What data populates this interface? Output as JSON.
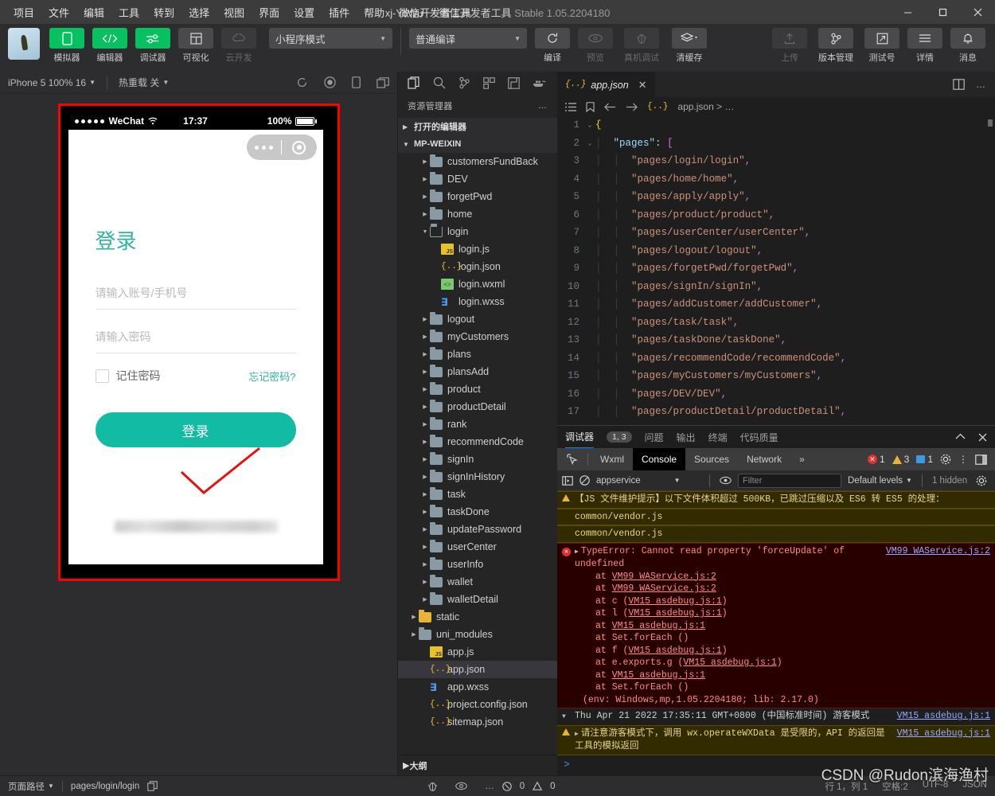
{
  "titlebar": {
    "menus": [
      "项目",
      "文件",
      "编辑",
      "工具",
      "转到",
      "选择",
      "视图",
      "界面",
      "设置",
      "插件",
      "帮助",
      "微信开发者工具"
    ],
    "project_name": "xj-YeWu",
    "separator": "－",
    "app_name": "微信开发者工具",
    "version": "Stable 1.05.2204180",
    "minimize": "—",
    "maximize": "▢",
    "close": "✕"
  },
  "toolbar": {
    "left_buttons": [
      {
        "label": "模拟器",
        "icon": "phone-icon",
        "state": "active"
      },
      {
        "label": "编辑器",
        "icon": "code-icon",
        "state": "active"
      },
      {
        "label": "调试器",
        "icon": "debug-sliders-icon",
        "state": "active"
      },
      {
        "label": "可视化",
        "icon": "layout-icon",
        "state": "normal"
      },
      {
        "label": "云开发",
        "icon": "cloud-icon",
        "state": "disabled"
      }
    ],
    "mode_select": "小程序模式",
    "compile_select": "普通编译",
    "mid_buttons": [
      {
        "label": "编译",
        "icon": "refresh-icon",
        "state": "normal"
      },
      {
        "label": "预览",
        "icon": "eye-icon",
        "state": "disabled"
      },
      {
        "label": "真机调试",
        "icon": "bug-icon",
        "state": "disabled"
      },
      {
        "label": "清缓存",
        "icon": "layers-icon",
        "state": "normal"
      }
    ],
    "right_buttons": [
      {
        "label": "上传",
        "icon": "upload-icon",
        "state": "disabled"
      },
      {
        "label": "版本管理",
        "icon": "branch-icon",
        "state": "normal"
      },
      {
        "label": "测试号",
        "icon": "external-link-icon",
        "state": "normal"
      },
      {
        "label": "详情",
        "icon": "menu-icon",
        "state": "normal"
      },
      {
        "label": "消息",
        "icon": "bell-icon",
        "state": "normal"
      }
    ]
  },
  "simulator": {
    "device": "iPhone 5 100% 16",
    "hot_reload": "热重载 关",
    "phone": {
      "status_carrier": "WeChat",
      "status_time": "17:37",
      "status_battery": "100%",
      "login_heading": "登录",
      "account_placeholder": "请输入账号/手机号",
      "password_placeholder": "请输入密码",
      "remember_label": "记住密码",
      "forgot_label": "忘记密码?",
      "submit_label": "登录"
    }
  },
  "explorer": {
    "title": "资源管理器",
    "open_editors": "打开的编辑器",
    "project_root": "MP-WEIXIN",
    "outline": "大纲",
    "tree": [
      {
        "name": "customersFundBack",
        "type": "folder",
        "indent": 2
      },
      {
        "name": "DEV",
        "type": "folder",
        "indent": 2
      },
      {
        "name": "forgetPwd",
        "type": "folder",
        "indent": 2
      },
      {
        "name": "home",
        "type": "folder",
        "indent": 2
      },
      {
        "name": "login",
        "type": "folder-open",
        "indent": 2
      },
      {
        "name": "login.js",
        "type": "js",
        "indent": 3
      },
      {
        "name": "login.json",
        "type": "json",
        "indent": 3
      },
      {
        "name": "login.wxml",
        "type": "wxml",
        "indent": 3
      },
      {
        "name": "login.wxss",
        "type": "wxss",
        "indent": 3
      },
      {
        "name": "logout",
        "type": "folder",
        "indent": 2
      },
      {
        "name": "myCustomers",
        "type": "folder",
        "indent": 2
      },
      {
        "name": "plans",
        "type": "folder",
        "indent": 2
      },
      {
        "name": "plansAdd",
        "type": "folder",
        "indent": 2
      },
      {
        "name": "product",
        "type": "folder",
        "indent": 2
      },
      {
        "name": "productDetail",
        "type": "folder",
        "indent": 2
      },
      {
        "name": "rank",
        "type": "folder",
        "indent": 2
      },
      {
        "name": "recommendCode",
        "type": "folder",
        "indent": 2
      },
      {
        "name": "signIn",
        "type": "folder",
        "indent": 2
      },
      {
        "name": "signInHistory",
        "type": "folder",
        "indent": 2
      },
      {
        "name": "task",
        "type": "folder",
        "indent": 2
      },
      {
        "name": "taskDone",
        "type": "folder",
        "indent": 2
      },
      {
        "name": "updatePassword",
        "type": "folder",
        "indent": 2
      },
      {
        "name": "userCenter",
        "type": "folder",
        "indent": 2
      },
      {
        "name": "userInfo",
        "type": "folder",
        "indent": 2
      },
      {
        "name": "wallet",
        "type": "folder",
        "indent": 2
      },
      {
        "name": "walletDetail",
        "type": "folder",
        "indent": 2
      },
      {
        "name": "static",
        "type": "folder-yellow",
        "indent": 1
      },
      {
        "name": "uni_modules",
        "type": "folder",
        "indent": 1
      },
      {
        "name": "app.js",
        "type": "js",
        "indent": 2
      },
      {
        "name": "app.json",
        "type": "json",
        "indent": 2,
        "selected": true
      },
      {
        "name": "app.wxss",
        "type": "wxss",
        "indent": 2
      },
      {
        "name": "project.config.json",
        "type": "json",
        "indent": 2
      },
      {
        "name": "sitemap.json",
        "type": "json",
        "indent": 2
      }
    ]
  },
  "editor": {
    "tab_name": "app.json",
    "tab_icon": "json-icon",
    "breadcrumb": "app.json > …",
    "lines": [
      {
        "n": 1,
        "fold": "v",
        "content": "{",
        "type": "brace"
      },
      {
        "n": 2,
        "fold": "v",
        "content": "\"pages\": [",
        "type": "key-open"
      },
      {
        "n": 3,
        "content": "\"pages/login/login\",",
        "type": "string"
      },
      {
        "n": 4,
        "content": "\"pages/home/home\",",
        "type": "string"
      },
      {
        "n": 5,
        "content": "\"pages/apply/apply\",",
        "type": "string"
      },
      {
        "n": 6,
        "content": "\"pages/product/product\",",
        "type": "string"
      },
      {
        "n": 7,
        "content": "\"pages/userCenter/userCenter\",",
        "type": "string"
      },
      {
        "n": 8,
        "content": "\"pages/logout/logout\",",
        "type": "string"
      },
      {
        "n": 9,
        "content": "\"pages/forgetPwd/forgetPwd\",",
        "type": "string"
      },
      {
        "n": 10,
        "content": "\"pages/signIn/signIn\",",
        "type": "string"
      },
      {
        "n": 11,
        "content": "\"pages/addCustomer/addCustomer\",",
        "type": "string"
      },
      {
        "n": 12,
        "content": "\"pages/task/task\",",
        "type": "string"
      },
      {
        "n": 13,
        "content": "\"pages/taskDone/taskDone\",",
        "type": "string"
      },
      {
        "n": 14,
        "content": "\"pages/recommendCode/recommendCode\",",
        "type": "string"
      },
      {
        "n": 15,
        "content": "\"pages/myCustomers/myCustomers\",",
        "type": "string"
      },
      {
        "n": 16,
        "content": "\"pages/DEV/DEV\",",
        "type": "string"
      },
      {
        "n": 17,
        "content": "\"pages/productDetail/productDetail\",",
        "type": "string"
      }
    ]
  },
  "debugger": {
    "tabs": [
      "调试器",
      "问题",
      "输出",
      "终端",
      "代码质量"
    ],
    "active_tab": "调试器",
    "count_badge": "1, 3",
    "devtools_tabs": [
      "Wxml",
      "Console",
      "Sources",
      "Network"
    ],
    "devtools_active": "Console",
    "more_tabs": "»",
    "error_count": "1",
    "warn_count": "3",
    "info_count": "1",
    "console": {
      "context": "appservice",
      "filter_placeholder": "Filter",
      "levels": "Default levels",
      "hidden": "1 hidden"
    },
    "messages": [
      {
        "kind": "warn",
        "text": "【JS 文件维护提示】以下文件体积超过 500KB，已跳过压缩以及 ES6 转 ES5 的处理：",
        "src": "",
        "partial": true
      },
      {
        "kind": "warn",
        "text": "common/vendor.js",
        "src": ""
      },
      {
        "kind": "warn",
        "text": "common/vendor.js",
        "src": ""
      },
      {
        "kind": "error",
        "text": "TypeError: Cannot read property 'forceUpdate' of undefined",
        "src": "VM99 WAService.js:2",
        "stack": [
          "at VM99 WAService.js:2",
          "at VM99 WAService.js:2",
          "at c (VM15 asdebug.js:1)",
          "at l (VM15 asdebug.js:1)",
          "at VM15 asdebug.js:1",
          "at Set.forEach (<anonymous>)",
          "at f (VM15 asdebug.js:1)",
          "at e.exports.g (VM15 asdebug.js:1)",
          "at VM15 asdebug.js:1",
          "at Set.forEach (<anonymous>)"
        ],
        "env": "(env: Windows,mp,1.05.2204180; lib: 2.17.0)"
      },
      {
        "kind": "plain",
        "text": "Thu Apr 21 2022 17:35:11 GMT+0800 (中国标准时间) 游客模式",
        "src": "VM15 asdebug.js:1"
      },
      {
        "kind": "warn2",
        "text": "请注意游客模式下，调用 wx.operateWXData 是受限的，API 的返回是工具的模拟返回",
        "src": "VM15 asdebug.js:1"
      }
    ]
  },
  "statusbar": {
    "page_path_label": "页面路径",
    "page_path": "pages/login/login",
    "error_count": "0",
    "warn_count": "0",
    "cursor": "行 1，列 1",
    "spaces": "空格:2",
    "encoding": "UTF-8",
    "language": "JSON"
  },
  "watermark": "CSDN @Rudon滨海渔村",
  "colors": {
    "accent_green": "#07c160",
    "teal": "#11bba4",
    "error_red": "#e03131",
    "link_blue": "#3b9ae1"
  }
}
